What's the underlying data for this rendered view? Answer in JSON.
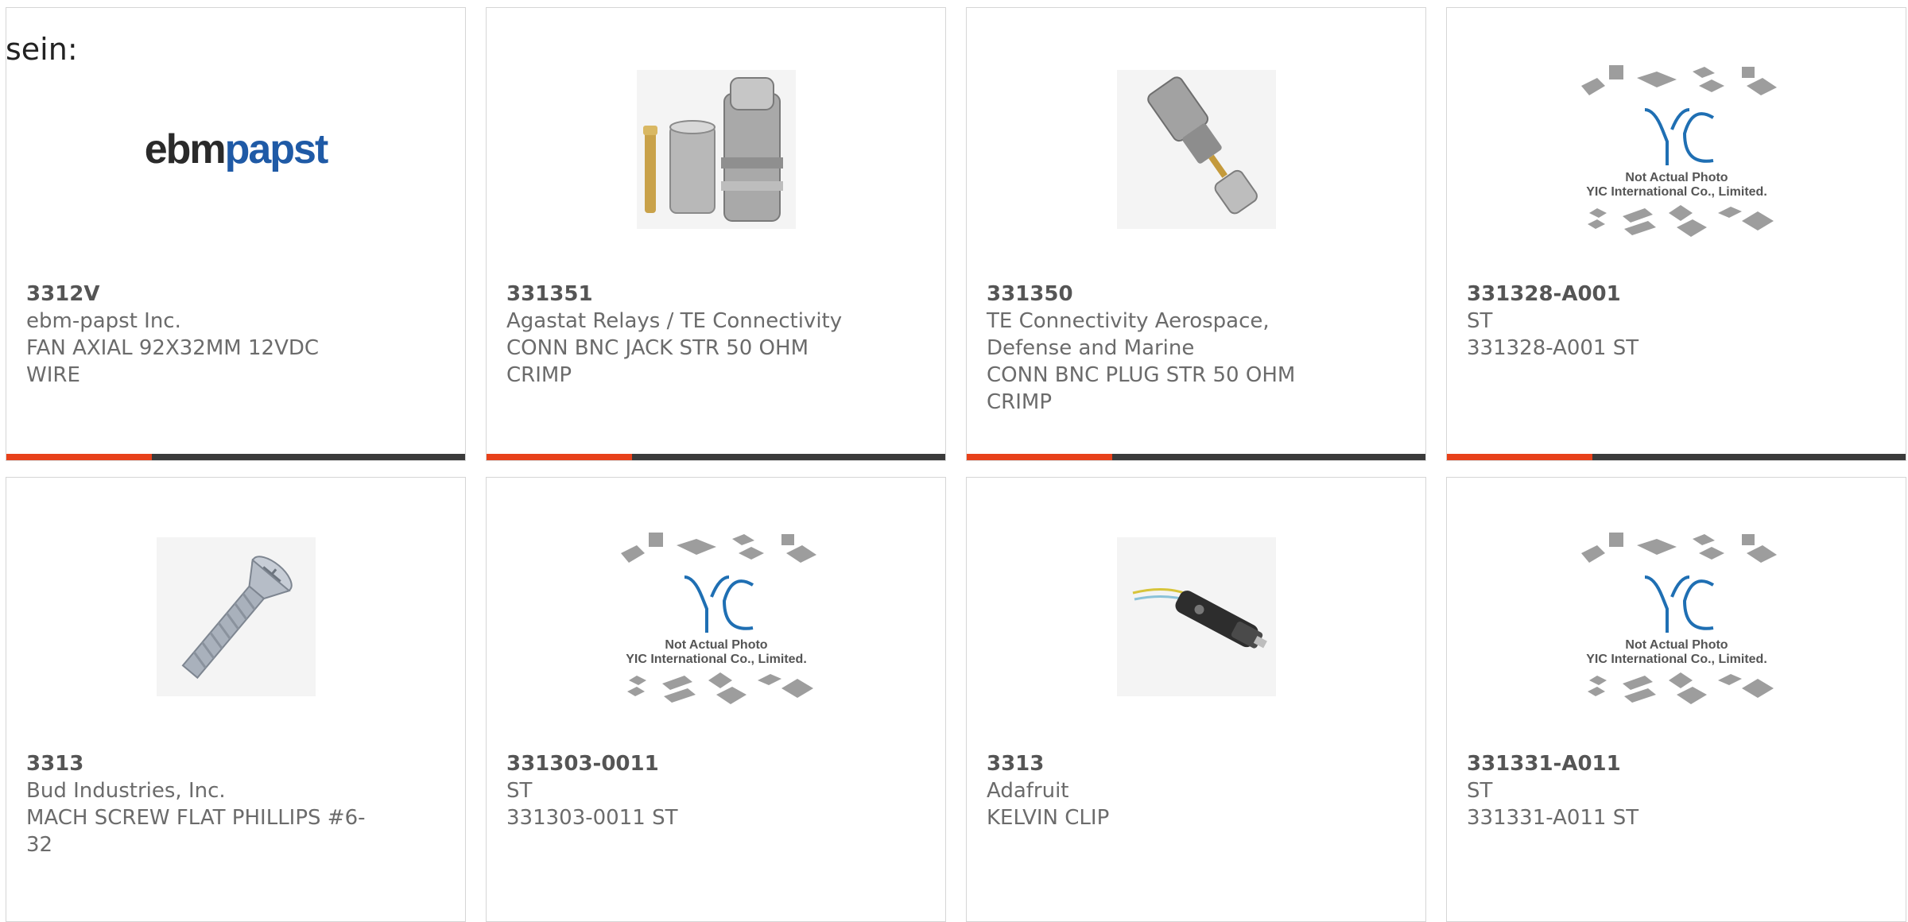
{
  "lead_text": "sein:",
  "colors": {
    "card_border": "#d6d6d6",
    "bar_dark": "#3b3b3b",
    "bar_accent": "#e8411a",
    "text_primary": "#555555",
    "text_secondary": "#6b6b6b",
    "yic_blue": "#1f6fb3"
  },
  "placeholder": {
    "line1": "Not Actual Photo",
    "line2": "YIC International Co., Limited.",
    "logo": "YIC"
  },
  "products": [
    {
      "part_number": "3312V",
      "manufacturer": "ebm-papst Inc.",
      "description": "FAN AXIAL 92X32MM 12VDC WIRE",
      "image": "ebmpapst-logo",
      "logo_text_a": "ebm",
      "logo_text_b": "papst"
    },
    {
      "part_number": "331351",
      "manufacturer": "Agastat Relays / TE Connectivity",
      "description": "CONN BNC JACK STR 50 OHM CRIMP",
      "image": "bnc-jack-photo"
    },
    {
      "part_number": "331350",
      "manufacturer": "TE Connectivity Aerospace, Defense and Marine",
      "description": "CONN BNC PLUG STR 50 OHM CRIMP",
      "image": "bnc-plug-photo"
    },
    {
      "part_number": "331328-A001",
      "manufacturer": "ST",
      "description": "331328-A001 ST",
      "image": "yic-placeholder"
    },
    {
      "part_number": "3313",
      "manufacturer": "Bud Industries, Inc.",
      "description": "MACH SCREW FLAT PHILLIPS #6-32",
      "image": "screw-photo"
    },
    {
      "part_number": "331303-0011",
      "manufacturer": "ST",
      "description": "331303-0011 ST",
      "image": "yic-placeholder"
    },
    {
      "part_number": "3313",
      "manufacturer": "Adafruit",
      "description": "KELVIN CLIP",
      "image": "kelvin-clip-photo"
    },
    {
      "part_number": "331331-A011",
      "manufacturer": "ST",
      "description": "331331-A011 ST",
      "image": "yic-placeholder"
    }
  ]
}
